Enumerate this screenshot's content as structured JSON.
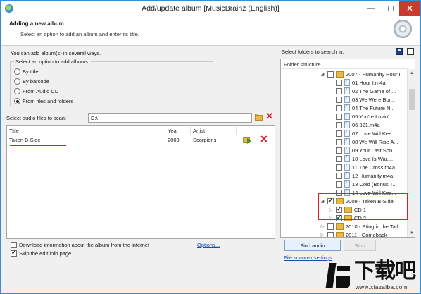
{
  "window": {
    "title": "Add/update album [MusicBrainz (English)]",
    "minimize_glyph": "—",
    "maximize_glyph": "☐",
    "close_glyph": "✕"
  },
  "header": {
    "title": "Adding a new album",
    "description": "Select an option to add an album and enter its title."
  },
  "options": {
    "intro": "You can add album(s) in several ways.",
    "group_label": "Select an option to add albums:",
    "items": [
      {
        "label": "By title",
        "checked": false
      },
      {
        "label": "By barcode",
        "checked": false
      },
      {
        "label": "From Audio CD",
        "checked": false
      },
      {
        "label": "From files and folders",
        "checked": true
      }
    ]
  },
  "scan": {
    "label": "Select audio files to scan:",
    "path": "D:\\",
    "clear_glyph": "✕"
  },
  "table": {
    "columns": [
      "Title",
      "Year",
      "Artist"
    ],
    "rows": [
      {
        "title": "Taken B-Side",
        "year": "2009",
        "artist": "Scorpions",
        "remove_glyph": "✕"
      }
    ]
  },
  "bottom_left": {
    "download_label": "Download information about the album from the internet",
    "download_checked": false,
    "skip_label": "Skip the edit info page",
    "skip_checked": true,
    "options_link": "Options..."
  },
  "folders": {
    "label": "Select folders to search in:",
    "header": "Folder structure",
    "tree": [
      {
        "label": "2007 - Humanity Hour I",
        "type": "folder",
        "indent": 0,
        "expander": "◢",
        "checked": false
      },
      {
        "label": "01 Hour I.m4a",
        "type": "file",
        "indent": 1,
        "checked": false
      },
      {
        "label": "02 The Game of ...",
        "type": "file",
        "indent": 1,
        "checked": false
      },
      {
        "label": "03 We Were Bor...",
        "type": "file",
        "indent": 1,
        "checked": false
      },
      {
        "label": "04 The Future N...",
        "type": "file",
        "indent": 1,
        "checked": false
      },
      {
        "label": "05 You're Lovin' ...",
        "type": "file",
        "indent": 1,
        "checked": false
      },
      {
        "label": "06 321.m4a",
        "type": "file",
        "indent": 1,
        "checked": false
      },
      {
        "label": "07 Love Will Kee...",
        "type": "file",
        "indent": 1,
        "checked": false
      },
      {
        "label": "08 We Will Rise A...",
        "type": "file",
        "indent": 1,
        "checked": false
      },
      {
        "label": "09 Your Last Son...",
        "type": "file",
        "indent": 1,
        "checked": false
      },
      {
        "label": "10 Love Is War....",
        "type": "file",
        "indent": 1,
        "checked": false
      },
      {
        "label": "11 The Cross.m4a",
        "type": "file",
        "indent": 1,
        "checked": false
      },
      {
        "label": "12 Humanity.m4a",
        "type": "file",
        "indent": 1,
        "checked": false
      },
      {
        "label": "13 Cold (Bonus T...",
        "type": "file",
        "indent": 1,
        "checked": false
      },
      {
        "label": "14 Love Will Kee...",
        "type": "file",
        "indent": 1,
        "checked": false
      },
      {
        "label": "2009 - Taken B-Side",
        "type": "folder",
        "indent": 0,
        "expander": "◢",
        "checked": true
      },
      {
        "label": "CD 1",
        "type": "folder",
        "indent": 1,
        "expander": "▷",
        "checked": true
      },
      {
        "label": "CD 2",
        "type": "folder",
        "indent": 1,
        "expander": "▷",
        "checked": true
      },
      {
        "label": "2010 - Sting in the Tail",
        "type": "folder",
        "indent": 0,
        "expander": "▷",
        "checked": false
      },
      {
        "label": "2011 - Comeback",
        "type": "folder",
        "indent": 0,
        "expander": "▷",
        "checked": false
      }
    ],
    "scroll_up": "▲",
    "scroll_down": "▼"
  },
  "actions": {
    "find_audio": "Find audio",
    "stop": "Stop",
    "scanner_link": "File scanner settings"
  },
  "watermark": {
    "big": "下载吧",
    "small": "www.xiazaiba.com"
  },
  "colors": {
    "accent": "#2f8fd8",
    "highlight": "#e0201e",
    "link": "#1a4fb0",
    "close": "#c73c2f"
  }
}
